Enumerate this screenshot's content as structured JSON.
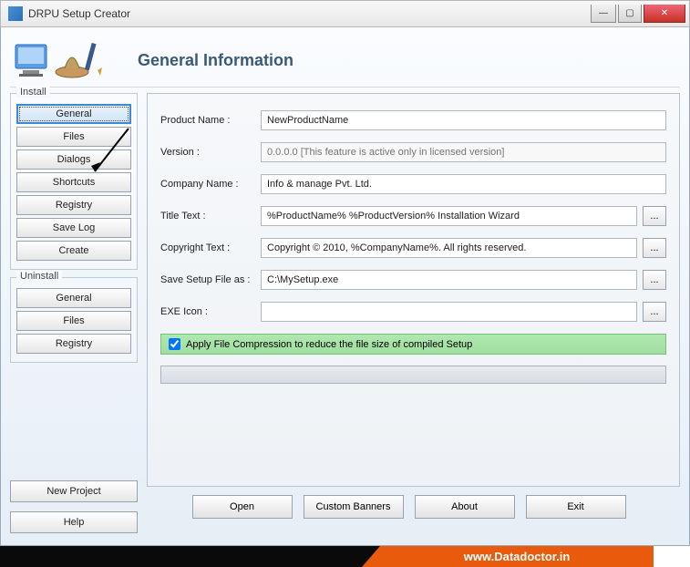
{
  "window": {
    "title": "DRPU Setup Creator"
  },
  "header": {
    "section_title": "General Information"
  },
  "sidebar": {
    "install": {
      "label": "Install",
      "items": [
        "General",
        "Files",
        "Dialogs",
        "Shortcuts",
        "Registry",
        "Save Log",
        "Create"
      ]
    },
    "uninstall": {
      "label": "Uninstall",
      "items": [
        "General",
        "Files",
        "Registry"
      ]
    }
  },
  "form": {
    "product_name": {
      "label": "Product Name :",
      "value": "NewProductName"
    },
    "version": {
      "label": "Version :",
      "placeholder": "0.0.0.0 [This feature is active only in licensed version]"
    },
    "company_name": {
      "label": "Company Name :",
      "value": "Info & manage Pvt. Ltd."
    },
    "title_text": {
      "label": "Title Text :",
      "value": "%ProductName% %ProductVersion% Installation Wizard"
    },
    "copyright_text": {
      "label": "Copyright Text :",
      "value": "Copyright © 2010, %CompanyName%. All rights reserved."
    },
    "save_as": {
      "label": "Save Setup File as :",
      "value": "C:\\MySetup.exe"
    },
    "exe_icon": {
      "label": "EXE Icon :",
      "value": ""
    },
    "browse": "...",
    "compress": {
      "label": "Apply File Compression to reduce the file size of compiled Setup",
      "checked": true
    }
  },
  "footer": {
    "new_project": "New Project",
    "help": "Help",
    "open": "Open",
    "custom_banners": "Custom Banners",
    "about": "About",
    "exit": "Exit"
  },
  "bottombar": {
    "url": "www.Datadoctor.in"
  }
}
